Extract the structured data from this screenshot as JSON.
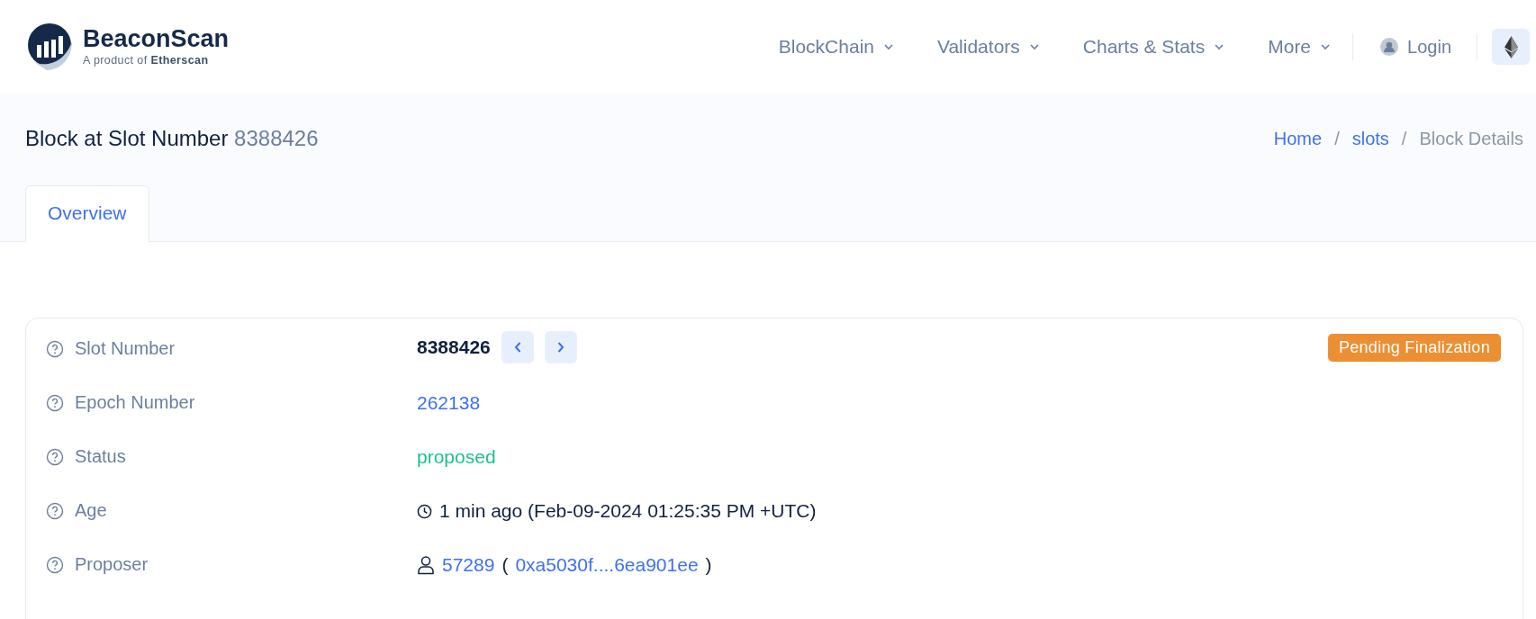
{
  "brand": {
    "name": "BeaconScan",
    "tagline_prefix": "A product of ",
    "tagline_brand": "Etherscan"
  },
  "nav": [
    {
      "label": "BlockChain",
      "kind": "dropdown"
    },
    {
      "label": "Validators",
      "kind": "dropdown"
    },
    {
      "label": "Charts & Stats",
      "kind": "dropdown"
    },
    {
      "label": "More",
      "kind": "dropdown"
    },
    {
      "label": "Login",
      "kind": "login"
    }
  ],
  "page": {
    "title": "Block at Slot Number",
    "title_number": "8388426"
  },
  "breadcrumb": [
    {
      "label": "Home",
      "kind": "link"
    },
    {
      "label": "/",
      "kind": "separator"
    },
    {
      "label": "slots",
      "kind": "link"
    },
    {
      "label": "/",
      "kind": "separator"
    },
    {
      "label": "Block Details",
      "kind": "current"
    }
  ],
  "tabs": [
    {
      "label": "Overview",
      "selected": true
    }
  ],
  "details": [
    {
      "label": "Slot Number",
      "kind": "slot",
      "value": "8388426",
      "badge": "Pending Finalization"
    },
    {
      "label": "Epoch Number",
      "kind": "link",
      "value": "262138"
    },
    {
      "label": "Status",
      "kind": "status",
      "value": "proposed"
    },
    {
      "label": "Age",
      "kind": "age",
      "value": "1 min ago (Feb-09-2024 01:25:35 PM +UTC)"
    },
    {
      "label": "Proposer",
      "kind": "proposer",
      "value": "57289",
      "open": "(",
      "address": "0xa5030f....6ea901ee",
      "close": ")"
    }
  ]
}
